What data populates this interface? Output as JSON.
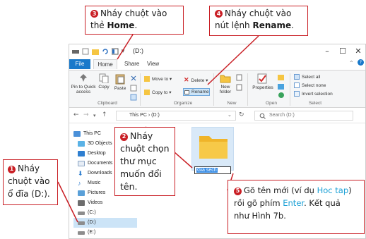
{
  "callouts": {
    "c1": {
      "num": "3",
      "text_before": "Nháy chuột vào thẻ ",
      "bold": "Home",
      "text_after": "."
    },
    "c2": {
      "num": "4",
      "text_before": "Nháy chuột vào nút lệnh ",
      "bold": "Rename",
      "text_after": "."
    },
    "c3": {
      "num": "2",
      "text": "Nháy chuột chọn thư mục muốn đổi tên."
    },
    "c4": {
      "num": "1",
      "text": "Nháy chuột vào ổ đĩa (D:)."
    },
    "c5": {
      "num": "5",
      "part1": "Gõ tên mới (ví dụ ",
      "hl1": "Hoc tap",
      "part2": ") rồi gõ phím ",
      "hl2": "Enter",
      "part3": ". Kết quả như Hình 7b."
    }
  },
  "window": {
    "title": "(D:)",
    "controls": {
      "minimize": "–",
      "maximize": "☐",
      "close": "✕"
    },
    "tabs": [
      "File",
      "Home",
      "Share",
      "View"
    ],
    "ribbon": {
      "clipboard": {
        "pin": "Pin to Quick access",
        "copy": "Copy",
        "paste": "Paste",
        "label": "Clipboard"
      },
      "organize": {
        "move_to": "Move to ▾",
        "delete": "Delete ▾",
        "copy_to": "Copy to ▾",
        "rename": "Rename",
        "label": "Organize"
      },
      "new": {
        "new_folder": "New folder",
        "label": "New"
      },
      "open": {
        "properties": "Properties",
        "label": "Open"
      },
      "select": {
        "select_all": "Select all",
        "select_none": "Select none",
        "invert": "Invert selection",
        "label": "Select"
      }
    },
    "address": {
      "path": "This PC  ›  (D:)",
      "search_placeholder": "Search (D:)"
    },
    "nav_items": [
      "This PC",
      "3D Objects",
      "Desktop",
      "Documents",
      "Downloads",
      "Music",
      "Pictures",
      "Videos",
      "(C:)",
      "(D:)",
      "(E:)"
    ],
    "folder_name": "Gia sech"
  },
  "colors": {
    "accent_red": "#c91f25",
    "highlight_blue": "#1aa0d6",
    "file_tab": "#1979ca"
  }
}
